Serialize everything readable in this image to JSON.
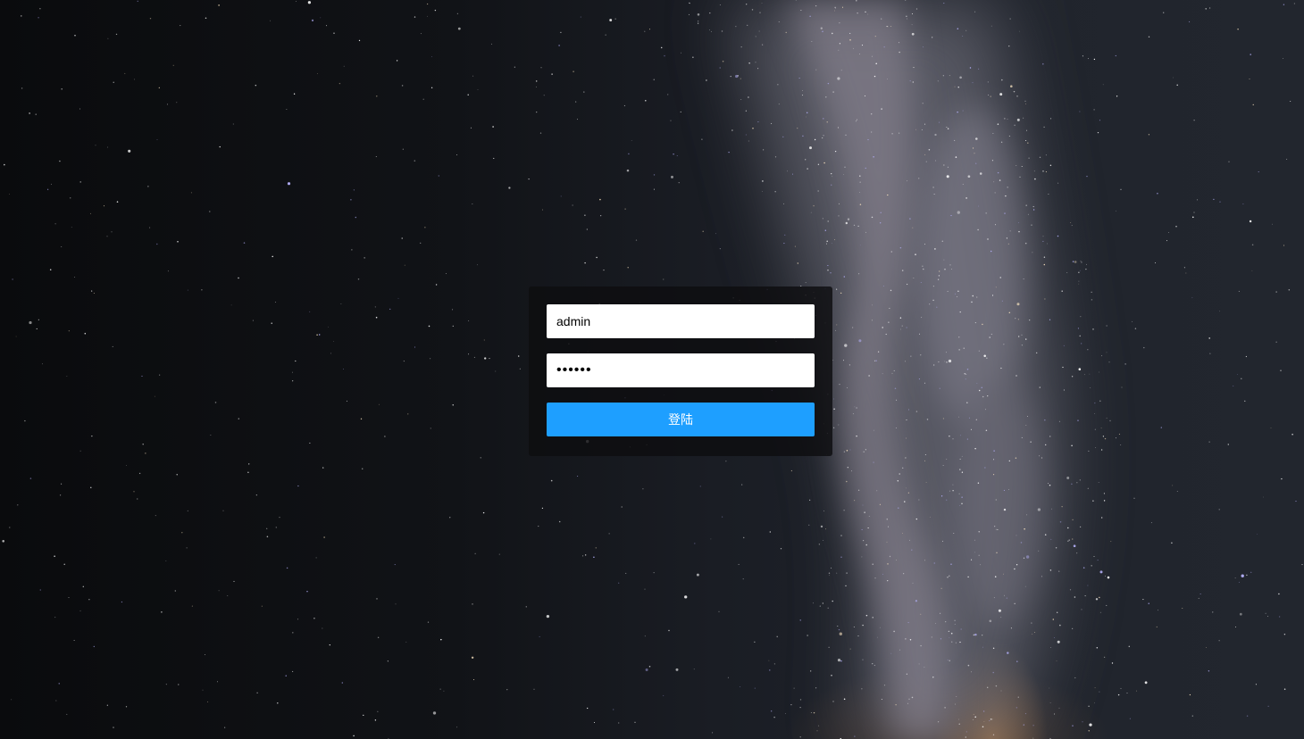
{
  "login": {
    "username_value": "admin",
    "password_value": "••••••",
    "submit_label": "登陆"
  },
  "colors": {
    "button": "#1e9fff",
    "panel": "#0e0e10",
    "sky": "#111317"
  }
}
